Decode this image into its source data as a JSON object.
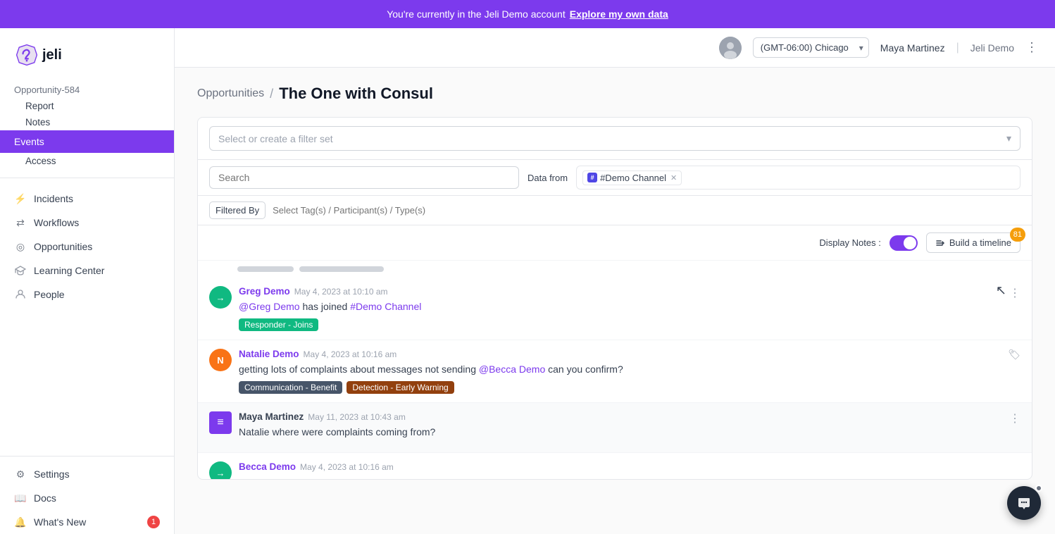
{
  "banner": {
    "text": "You're currently in the Jeli Demo account",
    "link_label": "Explore my own data"
  },
  "header": {
    "timezone": "(GMT-06:00) Chicago",
    "user_name": "Maya Martinez",
    "account_name": "Jeli Demo"
  },
  "sidebar": {
    "logo_text": "jeli",
    "opportunity_label": "Opportunity-584",
    "sub_items": [
      {
        "label": "Report",
        "id": "report"
      },
      {
        "label": "Notes",
        "id": "notes"
      },
      {
        "label": "Events",
        "id": "events"
      },
      {
        "label": "Access",
        "id": "access"
      }
    ],
    "nav_items": [
      {
        "label": "Incidents",
        "id": "incidents",
        "icon": "⚡"
      },
      {
        "label": "Workflows",
        "id": "workflows",
        "icon": "⇄"
      },
      {
        "label": "Opportunities",
        "id": "opportunities",
        "icon": "◎"
      },
      {
        "label": "Learning Center",
        "id": "learning-center",
        "icon": "🎓"
      },
      {
        "label": "People",
        "id": "people",
        "icon": "👤"
      }
    ],
    "bottom_items": [
      {
        "label": "Settings",
        "id": "settings",
        "icon": "⚙"
      },
      {
        "label": "Docs",
        "id": "docs",
        "icon": "📖"
      },
      {
        "label": "What's New",
        "id": "whats-new",
        "icon": "🔔",
        "badge": "1"
      }
    ]
  },
  "breadcrumb": {
    "parent": "Opportunities",
    "separator": "/",
    "current": "The One with Consul"
  },
  "filter_bar": {
    "select_placeholder": "Select or create a filter set",
    "search_placeholder": "Search",
    "data_from_label": "Data from",
    "channel_tag": "#Demo Channel",
    "filtered_by_label": "Filtered By",
    "filter_placeholder": "Select Tag(s) / Participant(s) / Type(s)"
  },
  "feed": {
    "display_notes_label": "Display Notes :",
    "build_timeline_label": "Build a timeline",
    "build_timeline_count": "81",
    "events": [
      {
        "id": "greg-join",
        "author": "Greg Demo",
        "time": "May 4, 2023 at 10:10 am",
        "text_parts": [
          "@Greg Demo",
          " has joined ",
          "#Demo Channel"
        ],
        "tags": [
          {
            "label": "Responder - Joins",
            "color": "green"
          }
        ],
        "avatar_letter": "→",
        "avatar_color": "green"
      },
      {
        "id": "natalie-msg",
        "author": "Natalie Demo",
        "time": "May 4, 2023 at 10:16 am",
        "text": "getting lots of complaints about messages not sending ",
        "mention": "@Becca Demo",
        "text_suffix": " can you confirm?",
        "tags": [
          {
            "label": "Communication - Benefit",
            "color": "slate"
          },
          {
            "label": "Detection - Early Warning",
            "color": "brown"
          }
        ],
        "avatar_letter": "N",
        "avatar_color": "orange"
      },
      {
        "id": "maya-msg",
        "author": "Maya Martinez",
        "time": "May 11, 2023 at 10:43 am",
        "text": "Natalie where were complaints coming from?",
        "tags": [],
        "avatar_letter": "≡",
        "avatar_color": "purple",
        "is_maya": true
      },
      {
        "id": "becca-partial",
        "author": "Becca Demo",
        "time": "May 4, 2023 at 10:16 am",
        "avatar_letter": "→",
        "avatar_color": "green",
        "partial": true
      }
    ]
  }
}
